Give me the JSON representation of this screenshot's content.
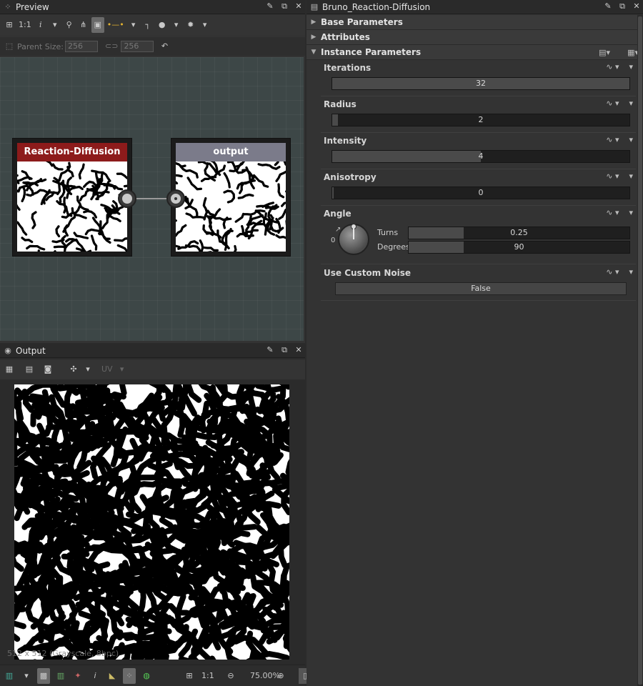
{
  "preview": {
    "title": "Preview",
    "toolbar": {
      "ratio": "1:1",
      "info": "i"
    },
    "parent_size_label": "Parent Size:",
    "parent_w": "256",
    "parent_h": "256"
  },
  "graph": {
    "node1": {
      "title": "Reaction-Diffusion",
      "color": "#8d1b1b"
    },
    "node2": {
      "title": "output",
      "color": "#7b7b8a"
    }
  },
  "output": {
    "title": "Output",
    "uv_label": "UV",
    "info_overlay": "512 x 512 (Grayscale, 8bpc)"
  },
  "bottombar": {
    "ratio": "1:1",
    "zoom": "75.00%"
  },
  "params": {
    "title": "Bruno_Reaction-Diffusion",
    "sections": [
      "Base Parameters",
      "Attributes",
      "Instance Parameters"
    ],
    "iterations": {
      "label": "Iterations",
      "value": "32",
      "fraction": 1.0
    },
    "radius": {
      "label": "Radius",
      "value": "2",
      "fraction": 0.02
    },
    "intensity": {
      "label": "Intensity",
      "value": "4",
      "fraction": 0.5
    },
    "anisotropy": {
      "label": "Anisotropy",
      "value": "0",
      "fraction": 0.0
    },
    "angle": {
      "label": "Angle",
      "dial_value": "0",
      "turns_label": "Turns",
      "turns_value": "0.25",
      "turns_fraction": 0.25,
      "degrees_label": "Degrees",
      "degrees_value": "90",
      "degrees_fraction": 0.25
    },
    "custom_noise": {
      "label": "Use Custom Noise",
      "value": "False"
    }
  }
}
